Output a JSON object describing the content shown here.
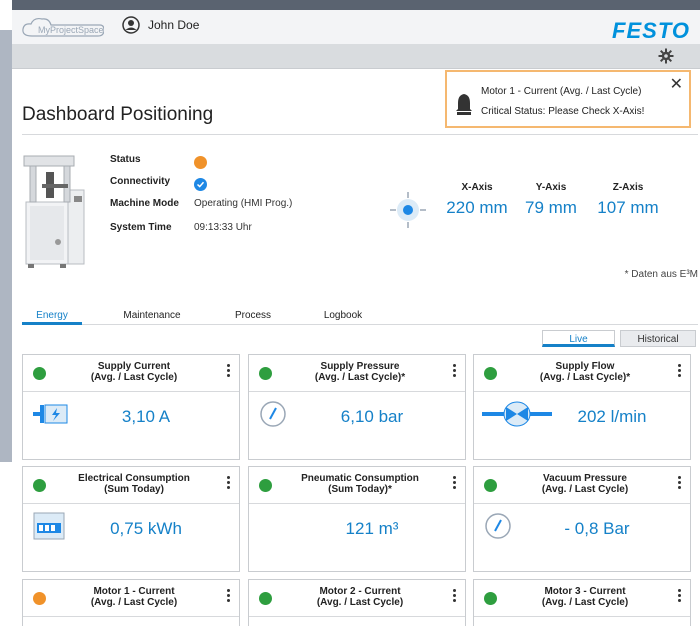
{
  "header": {
    "logo_text": "MyProjectSpace",
    "user_name": "John Doe",
    "brand": "FESTO"
  },
  "page": {
    "title": "Dashboard Positioning"
  },
  "notification": {
    "title": "Motor 1 - Current (Avg. / Last Cycle)",
    "message": "Critical Status: Please Check X-Axis!",
    "close": "✕"
  },
  "machine": {
    "status_label": "Status",
    "connectivity_label": "Connectivity",
    "mode_label": "Machine Mode",
    "mode_value": "Operating (HMI Prog.)",
    "time_label": "System Time",
    "time_value": "09:13:33 Uhr",
    "status_color": "#f0922a",
    "connectivity_color": "#1e88e5"
  },
  "axes": [
    {
      "label": "X-Axis",
      "value": "220 mm"
    },
    {
      "label": "Y-Axis",
      "value": "79 mm"
    },
    {
      "label": "Z-Axis",
      "value": "107 mm"
    }
  ],
  "note": "* Daten aus E³M",
  "tabs": [
    {
      "label": "Energy",
      "active": true
    },
    {
      "label": "Maintenance",
      "active": false
    },
    {
      "label": "Process",
      "active": false
    },
    {
      "label": "Logbook",
      "active": false
    }
  ],
  "view_toggle": {
    "live": "Live",
    "historical": "Historical"
  },
  "colors": {
    "ok": "#2e9e3f",
    "warn": "#f0922a",
    "accent": "#1581c8"
  },
  "cards": [
    {
      "title1": "Supply Current",
      "title2": "(Avg. / Last Cycle)",
      "value": "3,10 A",
      "status": "ok",
      "icon": "motor-icon"
    },
    {
      "title1": "Supply Pressure",
      "title2": "(Avg. / Last Cycle)*",
      "value": "6,10 bar",
      "status": "ok",
      "icon": "gauge-icon"
    },
    {
      "title1": "Supply Flow",
      "title2": "(Avg. / Last Cycle)*",
      "value": "202 l/min",
      "status": "ok",
      "icon": "valve-icon"
    },
    {
      "title1": "Electrical Consumption",
      "title2": "(Sum Today)",
      "value": "0,75 kWh",
      "status": "ok",
      "icon": "meter-icon"
    },
    {
      "title1": "Pneumatic Consumption",
      "title2": "(Sum Today)*",
      "value": "121 m³",
      "status": "ok",
      "icon": ""
    },
    {
      "title1": "Vacuum Pressure",
      "title2": "(Avg. / Last Cycle)",
      "value": "- 0,8 Bar",
      "status": "ok",
      "icon": "gauge-icon"
    },
    {
      "title1": "Motor 1 - Current",
      "title2": "(Avg. / Last Cycle)",
      "value": "",
      "status": "warn",
      "icon": ""
    },
    {
      "title1": "Motor 2 - Current",
      "title2": "(Avg. / Last Cycle)",
      "value": "",
      "status": "ok",
      "icon": ""
    },
    {
      "title1": "Motor 3 - Current",
      "title2": "(Avg. / Last Cycle)",
      "value": "",
      "status": "ok",
      "icon": ""
    }
  ]
}
